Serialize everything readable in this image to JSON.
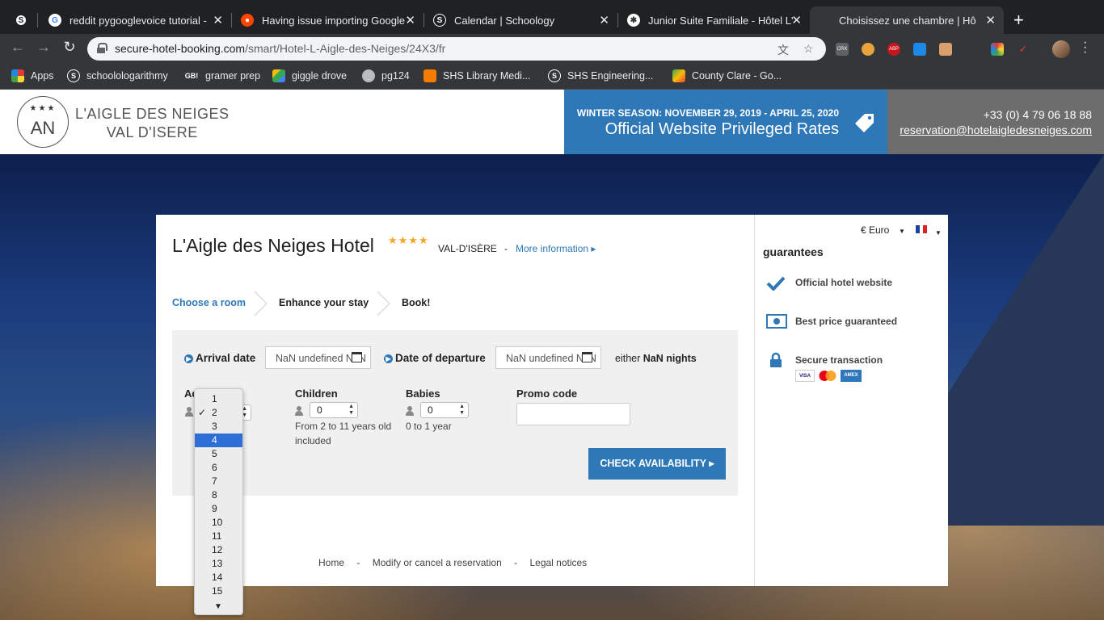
{
  "browser": {
    "tabs": [
      {
        "title": "reddit pygooglevoice tutorial -",
        "favicon": "google-icon"
      },
      {
        "title": "Having issue importing Google",
        "favicon": "reddit-icon"
      },
      {
        "title": "Calendar | Schoology",
        "favicon": "schoology-icon"
      },
      {
        "title": "Junior Suite Familiale - Hôtel L'",
        "favicon": "hotel-icon"
      },
      {
        "title": "Choisissez une chambre | Hôte",
        "favicon": "hotel-icon"
      }
    ],
    "url_host": "secure-hotel-booking.com",
    "url_path": "/smart/Hotel-L-Aigle-des-Neiges/24X3/fr",
    "bookmarks": [
      {
        "label": "Apps",
        "icon": "apps-grid-icon"
      },
      {
        "label": "schoolologarithmy",
        "icon": "schoology-icon"
      },
      {
        "label": "gramer prep",
        "icon": "gb-icon"
      },
      {
        "label": "giggle drove",
        "icon": "drive-icon"
      },
      {
        "label": "pg124",
        "icon": "globe-icon"
      },
      {
        "label": "SHS Library Medi...",
        "icon": "library-icon"
      },
      {
        "label": "SHS Engineering...",
        "icon": "schoology-icon"
      },
      {
        "label": "County Clare - Go...",
        "icon": "maps-icon"
      }
    ],
    "extensions": {
      "crx_label": "CRX",
      "abp_label": "ABP"
    }
  },
  "header": {
    "logo_stars": "★★★",
    "logo_mono": "AN",
    "logo_line1": "L'AIGLE DES NEIGES",
    "logo_line2": "VAL D'ISERE",
    "season": "WINTER SEASON: NOVEMBER 29, 2019 - APRIL 25, 2020",
    "rates": "Official Website Privileged Rates",
    "phone": "+33 (0) 4 79 06 18 88",
    "email": "reservation@hotelaigledesneiges.com"
  },
  "hotel": {
    "name": "L'Aigle des Neiges Hotel",
    "stars": "★★★★",
    "city": "VAL-D'ISÈRE",
    "dash": "-",
    "more_info": "More information ▸"
  },
  "steps": [
    "Choose a room",
    "Enhance your stay",
    "Book!"
  ],
  "form": {
    "arrival_label": "Arrival date",
    "arrival_value": "NaN undefined NaN",
    "departure_label": "Date of departure",
    "departure_value": "NaN undefined NaN",
    "nights_prefix": "either ",
    "nights_value": "NaN nights",
    "adults_label": "Adults",
    "adults_value": "2",
    "children_label": "Children",
    "children_value": "0",
    "children_hint": "From 2 to 11 years old included",
    "babies_label": "Babies",
    "babies_value": "0",
    "babies_hint": "0 to 1 year",
    "promo_label": "Promo code",
    "promo_value": "",
    "check_button": "CHECK AVAILABILITY  ▸"
  },
  "dropdown": {
    "options": [
      "1",
      "2",
      "3",
      "4",
      "5",
      "6",
      "7",
      "8",
      "9",
      "10",
      "11",
      "12",
      "13",
      "14",
      "15"
    ],
    "checked": "2",
    "highlighted": "4"
  },
  "footer": {
    "home": "Home",
    "sep": "-",
    "modify": "Modify or cancel a reservation",
    "legal": "Legal notices"
  },
  "side": {
    "currency": "€ Euro",
    "guarantees_title": "guarantees",
    "items": [
      "Official hotel website",
      "Best price guaranteed",
      "Secure transaction"
    ],
    "cards": [
      "VISA",
      "MC",
      "AMEX"
    ]
  },
  "colors": {
    "accent": "#2e78b7",
    "contact_bg": "#6d6d6d",
    "stars": "#f5a623"
  }
}
